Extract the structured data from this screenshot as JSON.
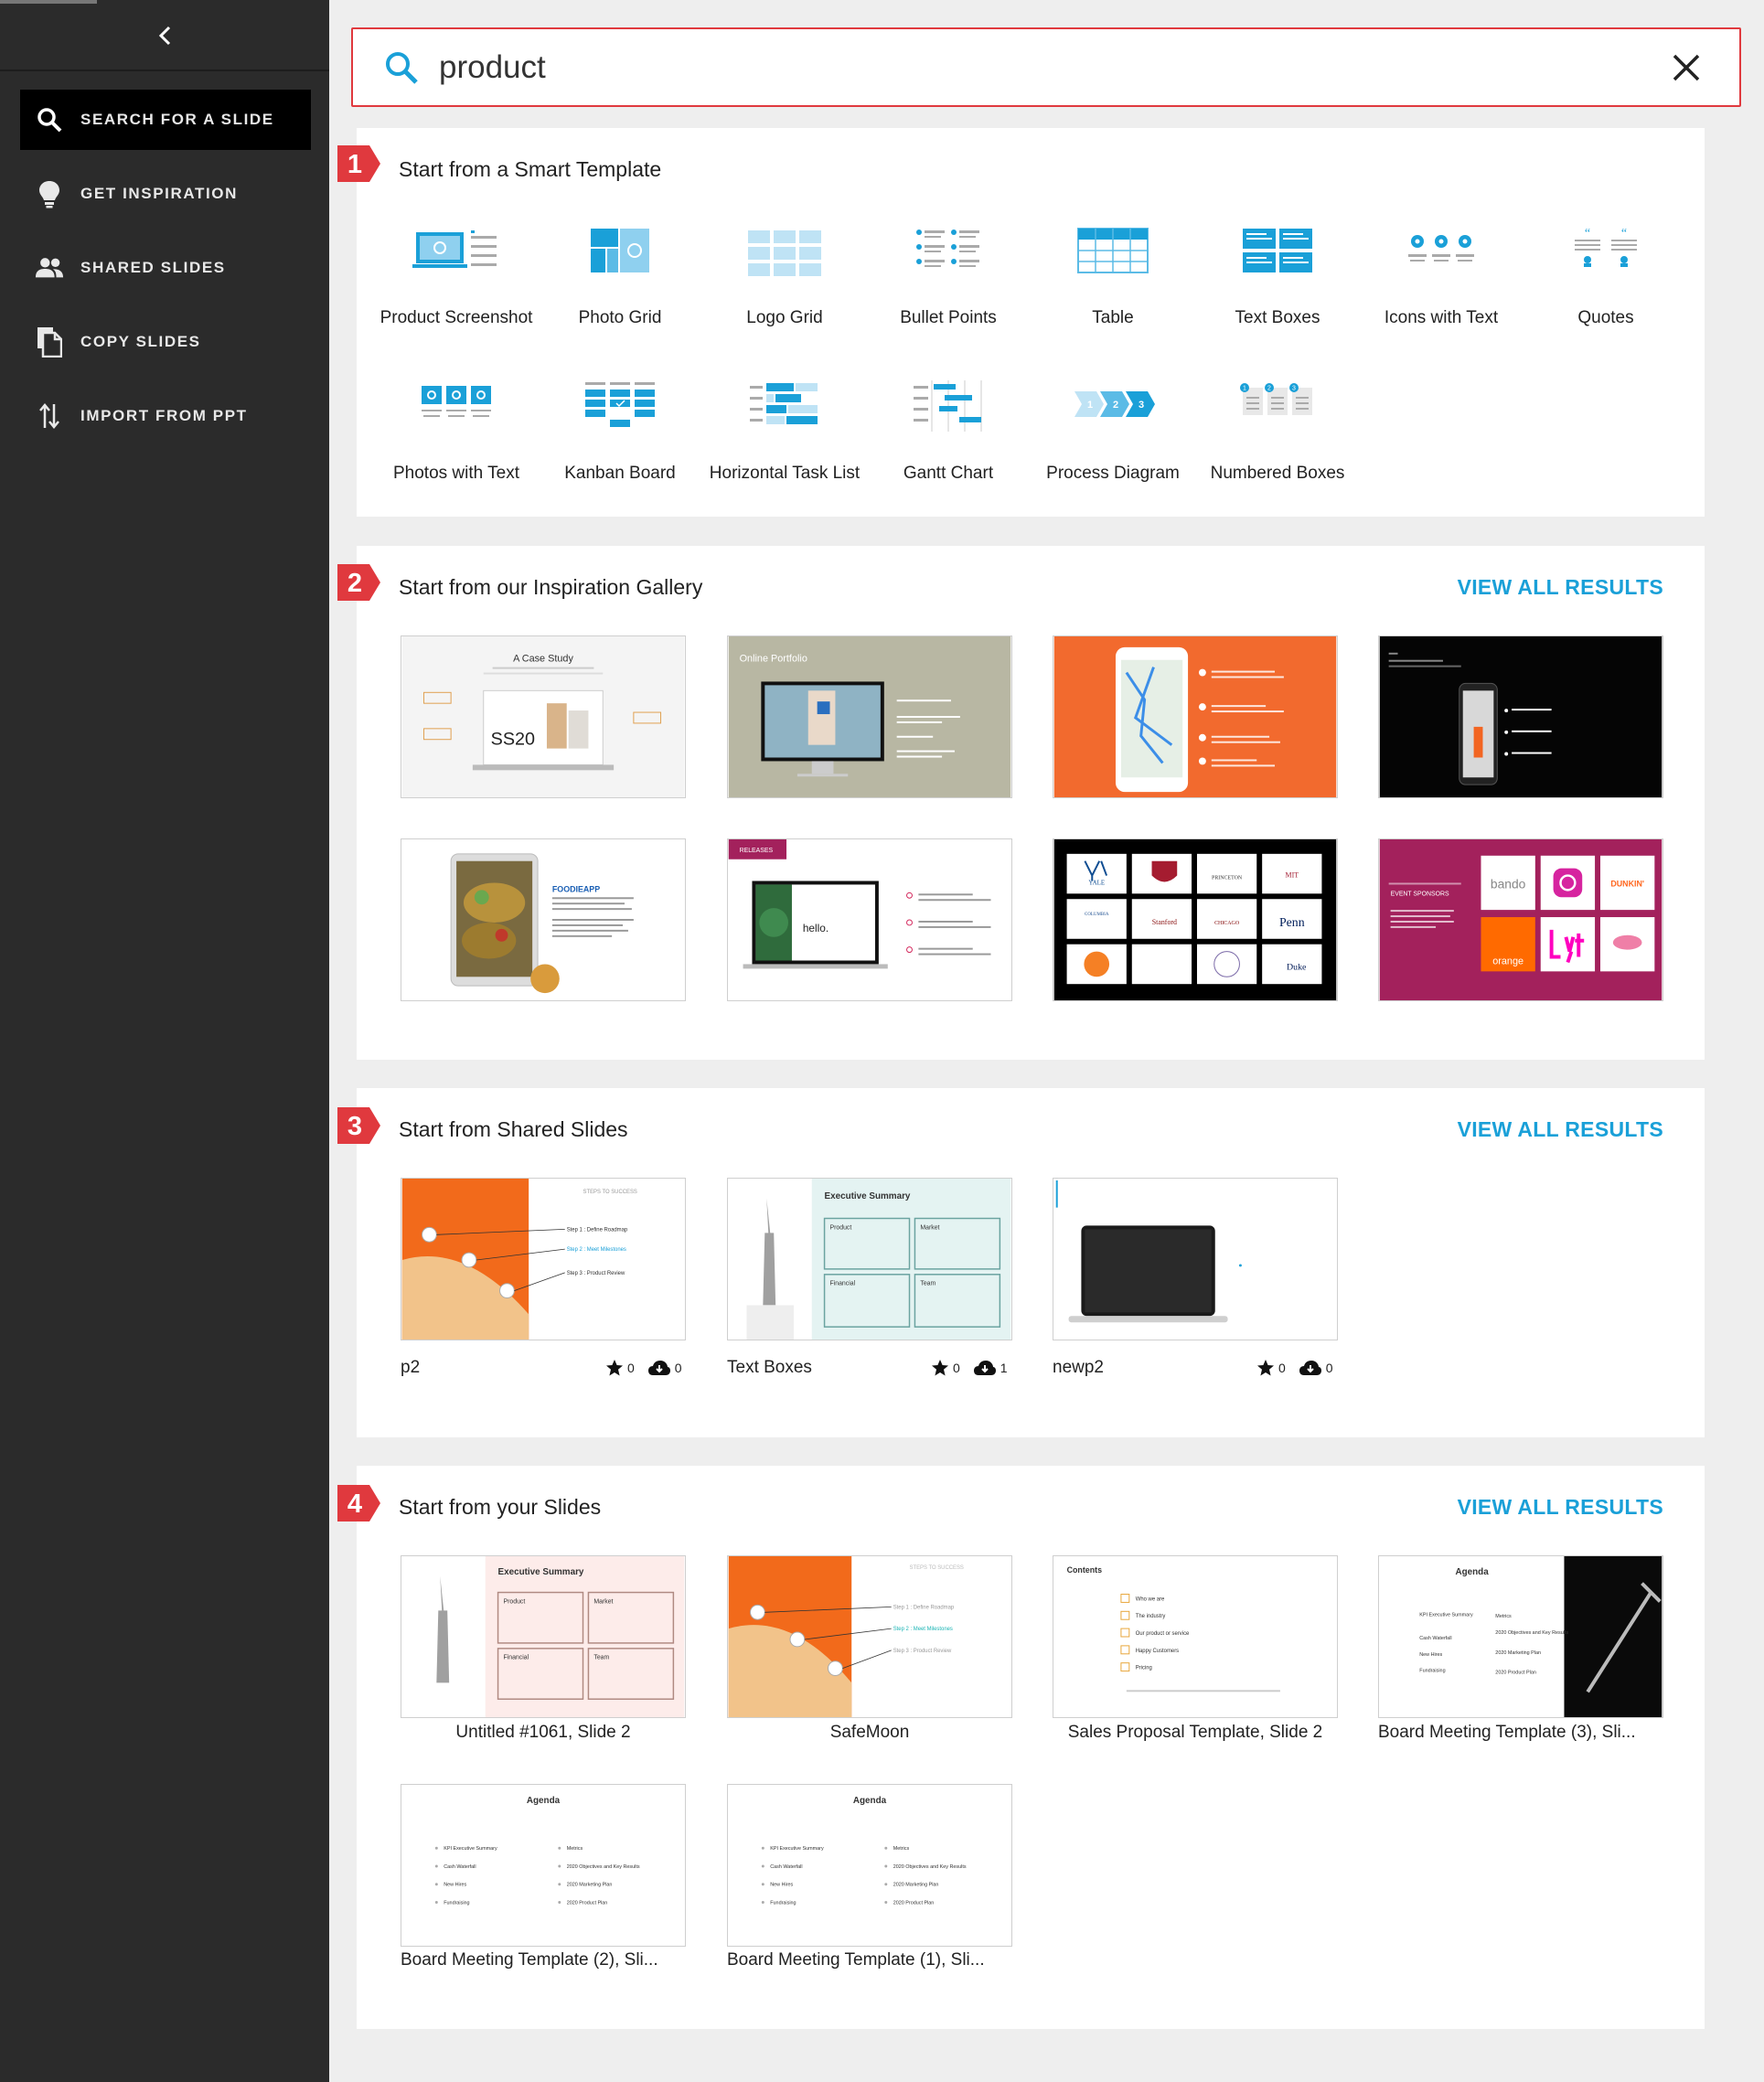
{
  "sidebar": {
    "items": [
      {
        "label": "SEARCH FOR A SLIDE",
        "icon": "search-icon"
      },
      {
        "label": "GET INSPIRATION",
        "icon": "lightbulb-icon"
      },
      {
        "label": "SHARED SLIDES",
        "icon": "people-icon"
      },
      {
        "label": "COPY SLIDES",
        "icon": "copy-icon"
      },
      {
        "label": "IMPORT FROM PPT",
        "icon": "import-icon"
      }
    ]
  },
  "search": {
    "value": "product"
  },
  "badges": [
    "1",
    "2",
    "3",
    "4"
  ],
  "sections": {
    "smart": {
      "title": "Start from a Smart Template"
    },
    "inspiration": {
      "title": "Start from our Inspiration Gallery",
      "view_all": "VIEW ALL RESULTS"
    },
    "shared": {
      "title": "Start from Shared Slides",
      "view_all": "VIEW ALL RESULTS"
    },
    "yours": {
      "title": "Start from your Slides",
      "view_all": "VIEW ALL RESULTS"
    }
  },
  "templates": [
    "Product Screenshot",
    "Photo Grid",
    "Logo Grid",
    "Bullet Points",
    "Table",
    "Text Boxes",
    "Icons with Text",
    "Quotes",
    "Photos with Text",
    "Kanban Board",
    "Horizontal Task List",
    "Gantt Chart",
    "Process Diagram",
    "Numbered Boxes"
  ],
  "inspiration_thumbs": {
    "case_study_title": "A Case Study",
    "case_study_code": "SS20",
    "portfolio_title": "Online Portfolio",
    "foodie_title": "FOODIEAPP",
    "releases_tag": "RELEASES",
    "hello_text": "hello.",
    "sponsors_tag": "EVENT SPONSORS",
    "brand_logos": [
      "bando",
      "DUNKIN'",
      "orange"
    ],
    "university_logos": [
      "YALE",
      "Stanford",
      "PRINCETON",
      "MIT",
      "COLUMBIA",
      "CHICAGO",
      "Penn",
      "Duke"
    ]
  },
  "shared_slides": [
    {
      "name": "p2",
      "stars": "0",
      "downloads": "0"
    },
    {
      "name": "Text Boxes",
      "stars": "0",
      "downloads": "1"
    },
    {
      "name": "newp2",
      "stars": "0",
      "downloads": "0"
    }
  ],
  "shared_thumbs": {
    "steps_title": "STEPS TO SUCCESS",
    "steps": [
      "Step 1 : Define Roadmap",
      "Step 2 : Meet Milestones",
      "Step 3 : Product Review"
    ],
    "exec_title": "Executive Summary",
    "exec_boxes": [
      "Product",
      "Market",
      "Financial",
      "Team"
    ]
  },
  "your_slides": [
    {
      "name": "Untitled #1061, Slide 2"
    },
    {
      "name": "SafeMoon"
    },
    {
      "name": "Sales Proposal Template, Slide 2"
    },
    {
      "name": "Board Meeting Template (3), Sli..."
    },
    {
      "name": "Board Meeting Template (2), Sli..."
    },
    {
      "name": "Board Meeting Template (1), Sli..."
    }
  ],
  "your_thumbs": {
    "contents_title": "Contents",
    "contents_items": [
      "Who we are",
      "The industry",
      "Our product or service",
      "Happy Customers",
      "Pricing"
    ],
    "agenda_title": "Agenda",
    "agenda_left": [
      "KPI Executive Summary",
      "Cash Waterfall",
      "New Hires",
      "Fundraising"
    ],
    "agenda_right": [
      "Metrics",
      "2020 Objectives and Key Results",
      "2020 Marketing Plan",
      "2020 Product Plan"
    ]
  },
  "colors": {
    "accent": "#1aa0d8",
    "badge": "#e0393e",
    "sidebar": "#2b2b2b",
    "orange": "#f26522",
    "magenta": "#a3215c"
  }
}
